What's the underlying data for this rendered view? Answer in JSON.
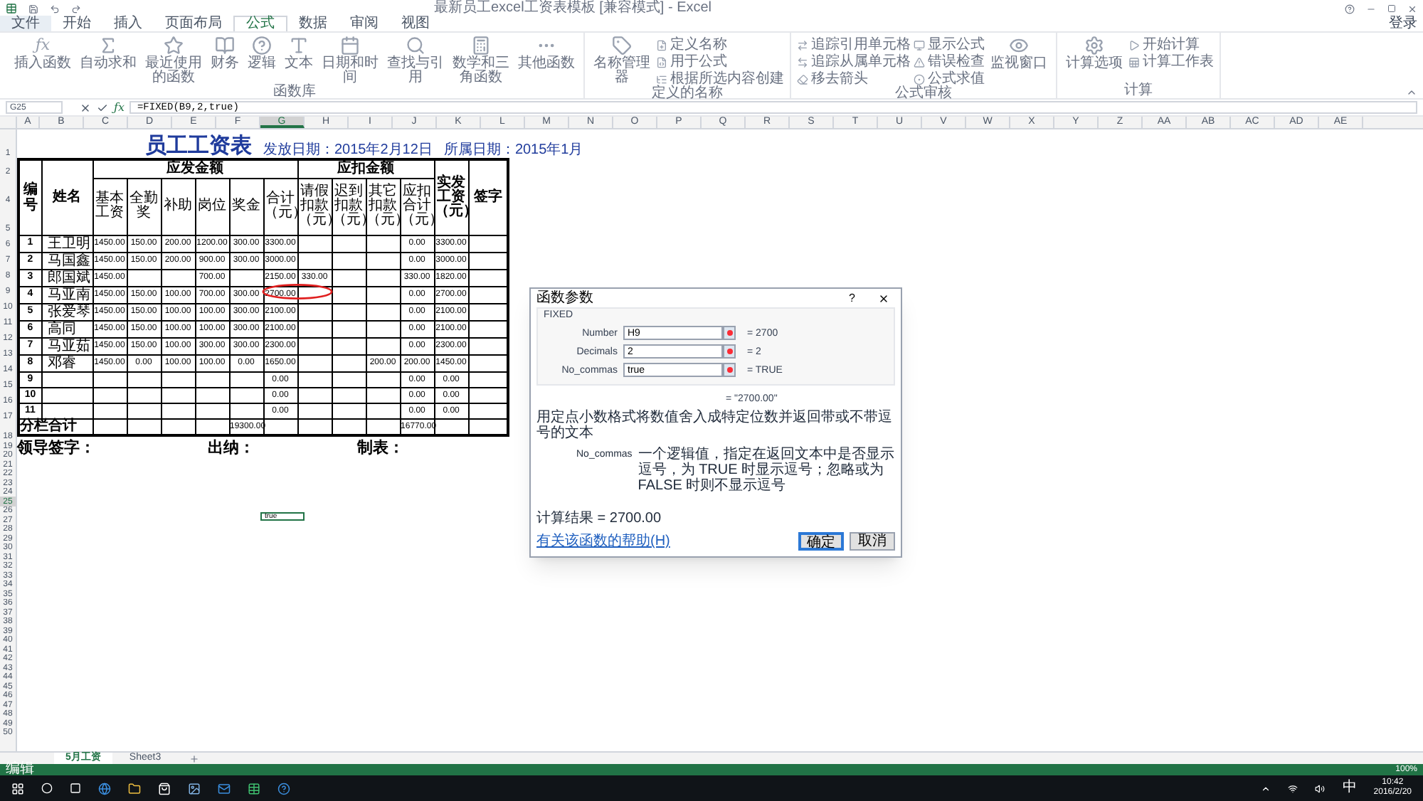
{
  "window": {
    "title": "最新员工excel工资表模板 [兼容模式] - Excel",
    "sign_in": "登录"
  },
  "ribbon_tabs": [
    {
      "label": "文件",
      "kind": "file",
      "selected": false
    },
    {
      "label": "开始",
      "kind": "tab",
      "selected": false
    },
    {
      "label": "插入",
      "kind": "tab",
      "selected": false
    },
    {
      "label": "页面布局",
      "kind": "tab",
      "selected": false
    },
    {
      "label": "公式",
      "kind": "tab",
      "selected": true
    },
    {
      "label": "数据",
      "kind": "tab",
      "selected": false
    },
    {
      "label": "审阅",
      "kind": "tab",
      "selected": false
    },
    {
      "label": "视图",
      "kind": "tab",
      "selected": false
    }
  ],
  "ribbon_groups": [
    {
      "label": "函数库",
      "buttons": [
        {
          "label": "插入函数",
          "kind": "large",
          "glyph": "ƒx"
        },
        {
          "label": "自动求和",
          "kind": "large"
        },
        {
          "label": "最近使用的函数",
          "kind": "large"
        },
        {
          "label": "财务",
          "kind": "large"
        },
        {
          "label": "逻辑",
          "kind": "large"
        },
        {
          "label": "文本",
          "kind": "large"
        },
        {
          "label": "日期和时间",
          "kind": "large"
        },
        {
          "label": "查找与引用",
          "kind": "large"
        },
        {
          "label": "数学和三角函数",
          "kind": "large"
        },
        {
          "label": "其他函数",
          "kind": "large"
        }
      ]
    },
    {
      "label": "定义的名称",
      "buttons": [
        {
          "label": "名称管理器",
          "kind": "large"
        },
        {
          "label": "定义名称",
          "kind": "small"
        },
        {
          "label": "用于公式",
          "kind": "small"
        },
        {
          "label": "根据所选内容创建",
          "kind": "small"
        }
      ]
    },
    {
      "label": "公式审核",
      "buttons": [
        {
          "label": "追踪引用单元格",
          "kind": "small"
        },
        {
          "label": "追踪从属单元格",
          "kind": "small"
        },
        {
          "label": "移去箭头",
          "kind": "small"
        },
        {
          "label": "显示公式",
          "kind": "small"
        },
        {
          "label": "错误检查",
          "kind": "small"
        },
        {
          "label": "公式求值",
          "kind": "small"
        },
        {
          "label": "监视窗口",
          "kind": "large"
        }
      ]
    },
    {
      "label": "计算",
      "buttons": [
        {
          "label": "计算选项",
          "kind": "large"
        },
        {
          "label": "开始计算",
          "kind": "small"
        },
        {
          "label": "计算工作表",
          "kind": "small"
        }
      ]
    }
  ],
  "formula_bar": {
    "name_box": "G25",
    "fx": "ƒx",
    "formula": "=FIXED(B9,2,true)"
  },
  "columns": [
    {
      "label": "A",
      "selected": false
    },
    {
      "label": "B",
      "selected": false
    },
    {
      "label": "C",
      "selected": false
    },
    {
      "label": "D",
      "selected": false
    },
    {
      "label": "E",
      "selected": false
    },
    {
      "label": "F",
      "selected": false
    },
    {
      "label": "G",
      "selected": true
    },
    {
      "label": "H",
      "selected": false
    },
    {
      "label": "I",
      "selected": false
    },
    {
      "label": "J",
      "selected": false
    },
    {
      "label": "K",
      "selected": false
    },
    {
      "label": "L",
      "selected": false
    },
    {
      "label": "M",
      "selected": false
    },
    {
      "label": "N",
      "selected": false
    },
    {
      "label": "O",
      "selected": false
    },
    {
      "label": "P",
      "selected": false
    },
    {
      "label": "Q",
      "selected": false
    },
    {
      "label": "R",
      "selected": false
    },
    {
      "label": "S",
      "selected": false
    },
    {
      "label": "T",
      "selected": false
    },
    {
      "label": "U",
      "selected": false
    },
    {
      "label": "V",
      "selected": false
    },
    {
      "label": "W",
      "selected": false
    },
    {
      "label": "X",
      "selected": false
    },
    {
      "label": "Y",
      "selected": false
    },
    {
      "label": "Z",
      "selected": false
    },
    {
      "label": "AA",
      "selected": false
    },
    {
      "label": "AB",
      "selected": false
    },
    {
      "label": "AC",
      "selected": false
    },
    {
      "label": "AD",
      "selected": false
    },
    {
      "label": "AE",
      "selected": false
    }
  ],
  "rows": [
    {
      "label": "1"
    },
    {
      "label": "2"
    },
    {
      "label": "4"
    },
    {
      "label": "5"
    },
    {
      "label": "6"
    },
    {
      "label": "7"
    },
    {
      "label": "8"
    },
    {
      "label": "9"
    },
    {
      "label": "10"
    },
    {
      "label": "11"
    },
    {
      "label": "12"
    },
    {
      "label": "13"
    },
    {
      "label": "14"
    },
    {
      "label": "15"
    },
    {
      "label": "16"
    },
    {
      "label": "17"
    },
    {
      "label": "18"
    },
    {
      "label": "19"
    },
    {
      "label": "20"
    },
    {
      "label": "21"
    },
    {
      "label": "22"
    },
    {
      "label": "23"
    },
    {
      "label": "24"
    },
    {
      "label": "25",
      "cell": {
        "text": "true",
        "selected": true
      }
    },
    {
      "label": "26"
    },
    {
      "label": "27"
    },
    {
      "label": "28"
    },
    {
      "label": "29"
    },
    {
      "label": "30"
    },
    {
      "label": "31"
    },
    {
      "label": "32"
    },
    {
      "label": "33"
    },
    {
      "label": "34"
    },
    {
      "label": "35"
    },
    {
      "label": "36"
    },
    {
      "label": "37"
    },
    {
      "label": "38"
    },
    {
      "label": "39"
    },
    {
      "label": "40"
    },
    {
      "label": "41"
    },
    {
      "label": "42"
    },
    {
      "label": "43"
    },
    {
      "label": "44"
    },
    {
      "label": "45"
    },
    {
      "label": "46"
    },
    {
      "label": "47"
    },
    {
      "label": "48"
    },
    {
      "label": "49"
    },
    {
      "label": "50"
    }
  ],
  "salary_table": {
    "title": "员工工资表",
    "issue_date": "发放日期：2015年2月12日",
    "period": "所属日期：2015年1月",
    "header": [
      {
        "label": "编号"
      },
      {
        "label": "姓名"
      },
      {
        "label": "应发金额",
        "columns": [
          "基本工资",
          "全勤奖",
          "补助",
          "岗位",
          "奖金",
          "合计（元）"
        ]
      },
      {
        "label": "应扣金额",
        "columns": [
          "请假扣款（元）",
          "迟到扣款（元）",
          "其它扣款（元）",
          "应扣合计（元）"
        ]
      },
      {
        "label": "实发工资（元）"
      },
      {
        "label": "签字"
      }
    ],
    "rows": [
      {
        "kind": "data",
        "cells": [
          "1",
          "王卫明",
          "1450.00",
          "150.00",
          "200.00",
          "1200.00",
          "300.00",
          "3300.00",
          null,
          null,
          null,
          "0.00",
          "3300.00"
        ]
      },
      {
        "kind": "data",
        "cells": [
          "2",
          "马国鑫",
          "1450.00",
          "150.00",
          "200.00",
          "900.00",
          "300.00",
          "3000.00",
          null,
          null,
          null,
          "0.00",
          "3000.00"
        ]
      },
      {
        "kind": "data",
        "cells": [
          "3",
          "郎国斌",
          "1450.00",
          null,
          null,
          "700.00",
          null,
          "2150.00",
          "330.00",
          null,
          null,
          "330.00",
          "1820.00"
        ]
      },
      {
        "kind": "data",
        "cells": [
          "4",
          "马亚南",
          "1450.00",
          "150.00",
          "100.00",
          "700.00",
          "300.00",
          "2700.00",
          null,
          null,
          null,
          "0.00",
          "2700.00"
        ]
      },
      {
        "kind": "data",
        "cells": [
          "5",
          "张爱琴",
          "1450.00",
          "150.00",
          "100.00",
          "100.00",
          "300.00",
          "2100.00",
          null,
          null,
          null,
          "0.00",
          "2100.00"
        ]
      },
      {
        "kind": "data",
        "cells": [
          "6",
          "高同",
          "1450.00",
          "150.00",
          "100.00",
          "100.00",
          "300.00",
          "2100.00",
          null,
          null,
          null,
          "0.00",
          "2100.00"
        ]
      },
      {
        "kind": "data",
        "cells": [
          "7",
          "马亚茹",
          "1450.00",
          "150.00",
          "100.00",
          "300.00",
          "300.00",
          "2300.00",
          null,
          null,
          null,
          "0.00",
          "2300.00"
        ]
      },
      {
        "kind": "data",
        "cells": [
          "8",
          "邓睿",
          "1450.00",
          "0.00",
          "100.00",
          "100.00",
          "0.00",
          "1650.00",
          null,
          null,
          "200.00",
          "200.00",
          "1450.00"
        ]
      },
      {
        "kind": "data",
        "cells": [
          "9",
          null,
          null,
          null,
          null,
          null,
          null,
          "0.00",
          null,
          null,
          null,
          "0.00",
          "0.00"
        ]
      },
      {
        "kind": "data",
        "cells": [
          "10",
          null,
          null,
          null,
          null,
          null,
          null,
          "0.00",
          null,
          null,
          null,
          "0.00",
          "0.00"
        ]
      },
      {
        "kind": "data",
        "cells": [
          "11",
          null,
          null,
          null,
          null,
          null,
          null,
          "0.00",
          null,
          null,
          null,
          "0.00",
          "0.00"
        ]
      },
      {
        "kind": "total",
        "cells": [
          {
            "text": "分栏合计",
            "colspan": 2
          },
          null,
          null,
          null,
          null,
          "19300.00",
          null,
          null,
          null,
          null,
          "16770.00"
        ]
      }
    ],
    "signatures": [
      "领导签字：",
      "出纳：",
      "制表："
    ]
  },
  "dialog": {
    "title": "函数参数",
    "help": "?",
    "function": "FIXED",
    "args": [
      {
        "name": "Number",
        "value": "H9",
        "result": "= 2700"
      },
      {
        "name": "Decimals",
        "value": "2",
        "result": "= 2"
      },
      {
        "name": "No_commas",
        "value": "true",
        "result": "= TRUE"
      }
    ],
    "result": "= \"2700.00\"",
    "description": "用定点小数格式将数值舍入成特定位数并返回带或不带逗号的文本",
    "arg_name": "No_commas",
    "arg_help": "一个逻辑值，指定在返回文本中是否显示逗号，为 TRUE 时显示逗号；忽略或为 FALSE 时则不显示逗号",
    "formula_result": "计算结果 =   2700.00",
    "help_link": "有关该函数的帮助(H)",
    "buttons": [
      {
        "label": "确定",
        "selected": true
      },
      {
        "label": "取消",
        "selected": false
      }
    ]
  },
  "sheet_tabs": [
    {
      "label": "5月工资",
      "selected": true
    },
    {
      "label": "Sheet3",
      "selected": false
    }
  ],
  "status_bar": {
    "mode": "编辑",
    "zoom": "100%"
  },
  "taskbar": {
    "ime": "中",
    "time": "10:42",
    "date": "2016/2/20"
  }
}
